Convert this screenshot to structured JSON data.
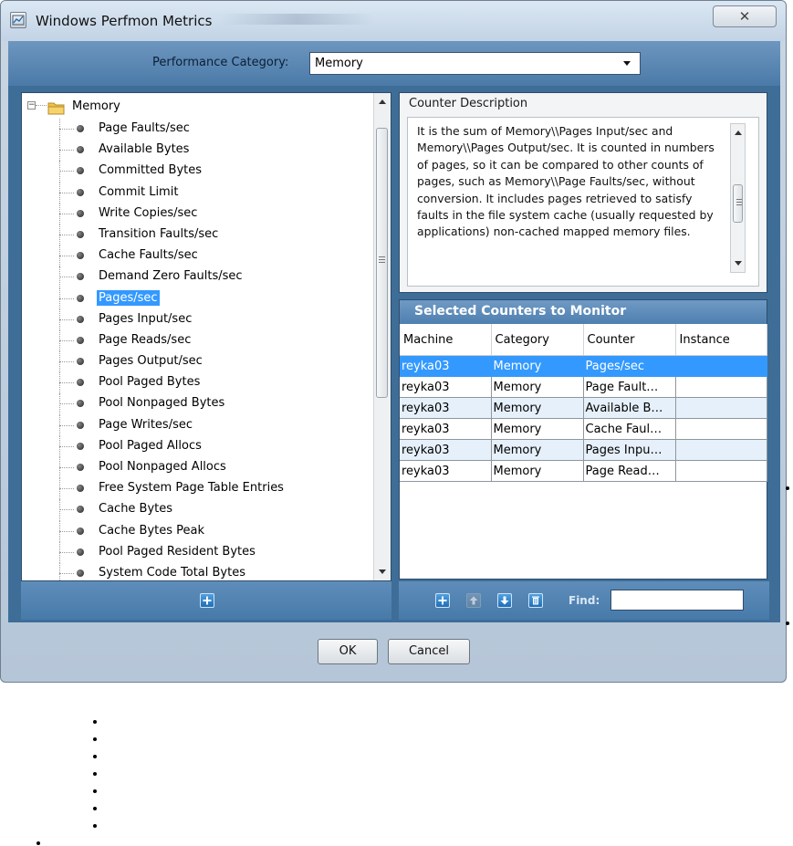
{
  "window": {
    "title": "Windows Perfmon Metrics",
    "close_label": "✕"
  },
  "performance": {
    "label": "Performance Category:",
    "selected": "Memory"
  },
  "tree": {
    "root": "Memory",
    "selected_index": 8,
    "items": [
      "Page Faults/sec",
      "Available Bytes",
      "Committed Bytes",
      "Commit Limit",
      "Write Copies/sec",
      "Transition Faults/sec",
      "Cache Faults/sec",
      "Demand Zero Faults/sec",
      "Pages/sec",
      "Pages Input/sec",
      "Page Reads/sec",
      "Pages Output/sec",
      "Pool Paged Bytes",
      "Pool Nonpaged Bytes",
      "Page Writes/sec",
      "Pool Paged Allocs",
      "Pool Nonpaged Allocs",
      "Free System Page Table Entries",
      "Cache Bytes",
      "Cache Bytes Peak",
      "Pool Paged Resident Bytes",
      "System Code Total Bytes"
    ]
  },
  "description": {
    "title": "Counter Description",
    "text": "It is the sum of Memory\\\\Pages Input/sec and Memory\\\\Pages Output/sec.  It is counted in numbers of pages, so it can be compared to other counts of pages, such as Memory\\\\Page Faults/sec, without conversion. It includes pages retrieved to satisfy faults in the file system cache (usually requested by applications) non-cached mapped memory files."
  },
  "counters": {
    "title": "Selected Counters to Monitor",
    "columns": [
      "Machine",
      "Category",
      "Counter",
      "Instance"
    ],
    "rows": [
      [
        "reyka03",
        "Memory",
        "Pages/sec",
        ""
      ],
      [
        "reyka03",
        "Memory",
        "Page Fault…",
        ""
      ],
      [
        "reyka03",
        "Memory",
        "Available B…",
        ""
      ],
      [
        "reyka03",
        "Memory",
        "Cache Faul…",
        ""
      ],
      [
        "reyka03",
        "Memory",
        "Pages Inpu…",
        ""
      ],
      [
        "reyka03",
        "Memory",
        "Page Read…",
        ""
      ]
    ],
    "find_label": "Find:",
    "find_value": ""
  },
  "buttons": {
    "ok": "OK",
    "cancel": "Cancel"
  },
  "colors": {
    "selection": "#3399ff",
    "panel_blue": "#4b7aa8"
  }
}
